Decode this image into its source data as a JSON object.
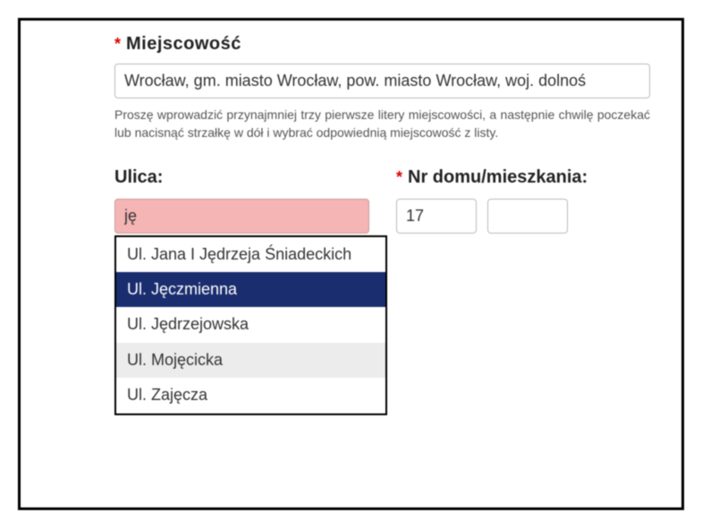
{
  "miejscowosc": {
    "label": "Miejscowość",
    "value": "Wrocław, gm. miasto Wrocław, pow. miasto Wrocław, woj. dolnoś",
    "hint": "Proszę wprowadzić przynajmniej trzy pierwsze litery miejscowości, a następnie chwilę poczekać lub nacisnąć strzałkę w dół i wybrać odpowiednią miejscowość z listy."
  },
  "ulica": {
    "label": "Ulica:",
    "value": "ję"
  },
  "nr": {
    "label": "Nr domu/mieszkania:",
    "value1": "17",
    "value2": ""
  },
  "autocomplete": {
    "items": [
      {
        "text": "Ul. Jana I Jędrzeja Śniadeckich",
        "selected": false,
        "alt": false
      },
      {
        "text": "Ul. Jęczmienna",
        "selected": true,
        "alt": false
      },
      {
        "text": "Ul. Jędrzejowska",
        "selected": false,
        "alt": false
      },
      {
        "text": "Ul. Mojęcicka",
        "selected": false,
        "alt": true
      },
      {
        "text": "Ul. Zajęcza",
        "selected": false,
        "alt": false
      }
    ]
  }
}
